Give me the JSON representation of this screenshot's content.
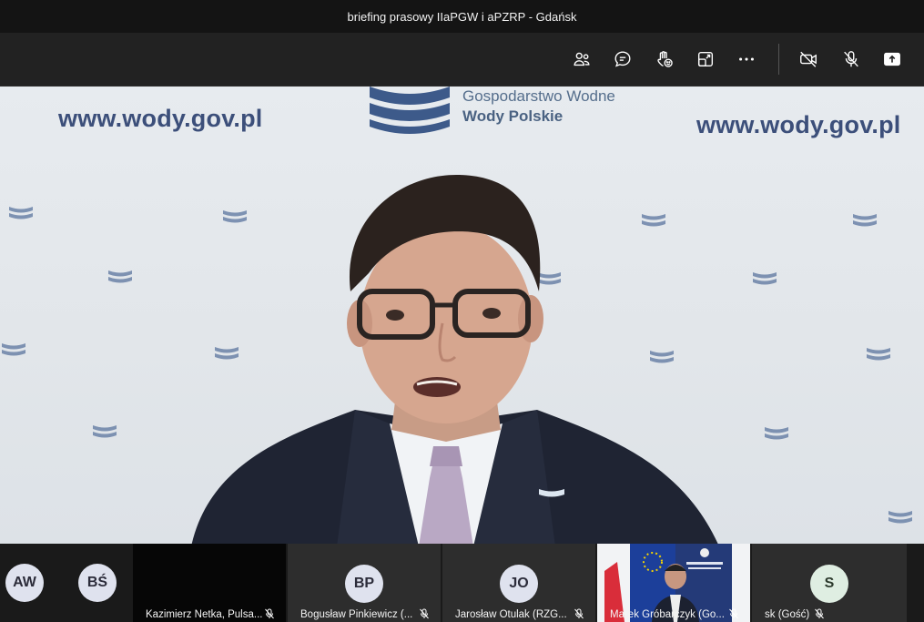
{
  "meeting": {
    "title": "briefing prasowy IIaPGW i aPZRP - Gdańsk"
  },
  "toolbar": {
    "buttons": [
      {
        "name": "people-icon"
      },
      {
        "name": "chat-icon"
      },
      {
        "name": "reactions-icon"
      },
      {
        "name": "share-tray-icon"
      },
      {
        "name": "more-options-icon"
      },
      {
        "name": "camera-off-icon"
      },
      {
        "name": "mic-off-icon"
      },
      {
        "name": "share-screen-icon"
      }
    ]
  },
  "stage": {
    "url_left": "www.wody.gov.pl",
    "url_right": "www.wody.gov.pl",
    "brand_line1": "Gospodarstwo Wodne",
    "brand_line2": "Wody Polskie",
    "brand_color": "#3c4f7a"
  },
  "participants": {
    "small_avatars": [
      {
        "initials": "AW"
      },
      {
        "initials": "BŚ"
      }
    ],
    "tiles": [
      {
        "name": "Kazimierz Netka, Pulsa...",
        "muted": true
      },
      {
        "initials": "BP",
        "name": "Bogusław Pinkiewicz (...",
        "muted": true
      },
      {
        "initials": "JO",
        "name": "Jarosław Otulak (RZG...",
        "muted": true
      },
      {
        "name": "Marek Gróbarczyk (Go...",
        "muted": true
      },
      {
        "initials": "S",
        "name": "sk (Gość)",
        "muted": true
      }
    ]
  },
  "colors": {
    "titlebar_bg": "#141414",
    "toolbar_bg": "#222222",
    "tile_bg": "#2d2d2d",
    "avatar_bg": "#dfe2ee"
  }
}
